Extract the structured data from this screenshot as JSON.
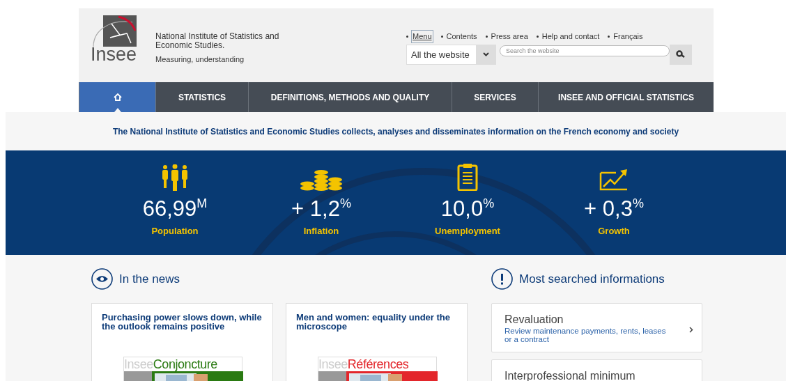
{
  "logo": {
    "wordmark": "Insee"
  },
  "header": {
    "name": "National Institute of Statistics and Economic Studies.",
    "slogan": "Measuring, understanding"
  },
  "top_links": [
    {
      "label": "Menu",
      "focused": true
    },
    {
      "label": "Contents",
      "focused": false
    },
    {
      "label": "Press area",
      "focused": false
    },
    {
      "label": "Help and contact",
      "focused": false
    },
    {
      "label": "Français",
      "focused": false
    }
  ],
  "search": {
    "scope": "All the website",
    "placeholder": "Search the website"
  },
  "nav": [
    {
      "kind": "home",
      "selected": true
    },
    {
      "kind": "text",
      "label": "STATISTICS",
      "selected": false
    },
    {
      "kind": "text",
      "label": "DEFINITIONS, METHODS AND QUALITY",
      "selected": false
    },
    {
      "kind": "text",
      "label": "SERVICES",
      "selected": false
    },
    {
      "kind": "text",
      "label": "INSEE AND OFFICIAL STATISTICS",
      "selected": false
    }
  ],
  "tagline": "The National Institute of Statistics and Economic Studies collects, analyses and disseminates information on the French economy and society",
  "key_figures": [
    {
      "kind": "people",
      "value": "66,99$^{M}$",
      "label": "Population"
    },
    {
      "kind": "coins",
      "value": "+ 1,2$^{%}$",
      "label": "Inflation"
    },
    {
      "kind": "clipboard",
      "value": "10,0$^{%}$",
      "label": "Unemployment"
    },
    {
      "kind": "chart",
      "value": "+ 0,3$^{%}$",
      "label": "Growth"
    }
  ],
  "news": {
    "title": "In the news",
    "cards": [
      {
        "title": "Purchasing power slows down, while the outlook remains positive",
        "cover": [
          "Insee",
          "Conjoncture"
        ],
        "color": "#2a7a12"
      },
      {
        "title": "Men and women: equality under the microscope",
        "cover": [
          "Insee",
          "Références"
        ],
        "color": "#e3262b"
      }
    ]
  },
  "most_searched": {
    "title": "Most searched informations",
    "items": [
      {
        "title": "Revaluation",
        "description": "Review maintenance payments, rents, leases or a contract"
      },
      {
        "title": "Interprofessional minimum"
      }
    ]
  }
}
